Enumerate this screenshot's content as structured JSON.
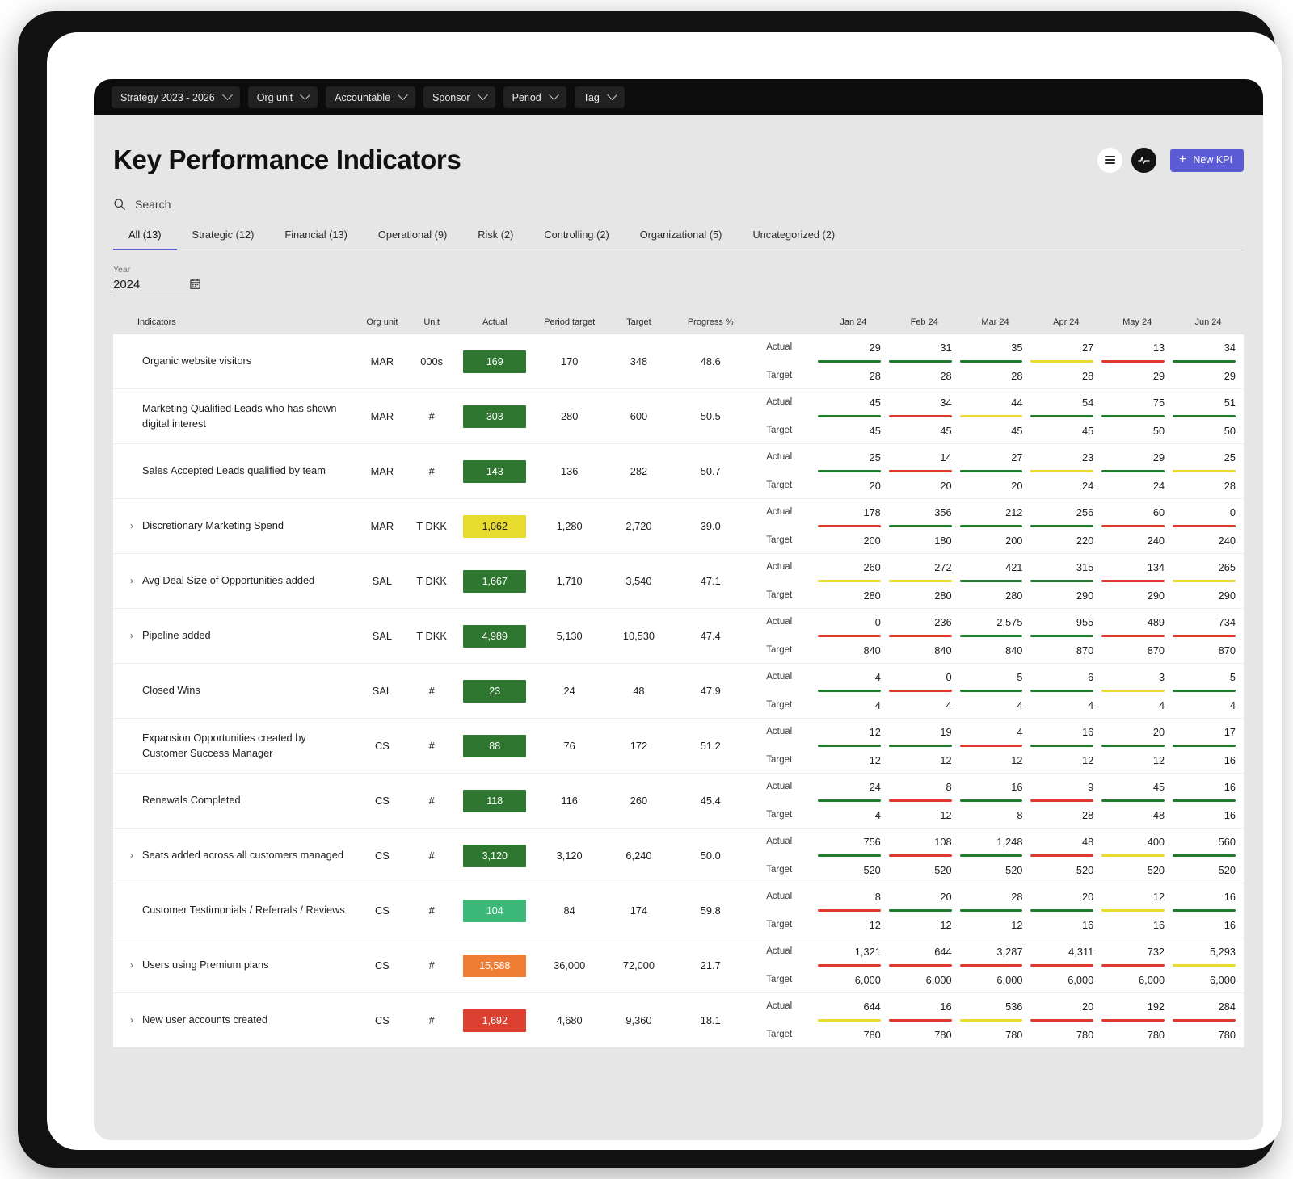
{
  "filters": [
    {
      "label": "Strategy 2023 - 2026",
      "name": "strategy"
    },
    {
      "label": "Org unit",
      "name": "org-unit"
    },
    {
      "label": "Accountable",
      "name": "accountable"
    },
    {
      "label": "Sponsor",
      "name": "sponsor"
    },
    {
      "label": "Period",
      "name": "period"
    },
    {
      "label": "Tag",
      "name": "tag"
    }
  ],
  "header": {
    "title": "Key Performance Indicators",
    "new_kpi_label": "New KPI",
    "plus": "+"
  },
  "search": {
    "label": "Search"
  },
  "tabs": [
    {
      "label": "All (13)",
      "active": true
    },
    {
      "label": "Strategic (12)",
      "active": false
    },
    {
      "label": "Financial (13)",
      "active": false
    },
    {
      "label": "Operational (9)",
      "active": false
    },
    {
      "label": "Risk (2)",
      "active": false
    },
    {
      "label": "Controlling (2)",
      "active": false
    },
    {
      "label": "Organizational (5)",
      "active": false
    },
    {
      "label": "Uncategorized (2)",
      "active": false
    }
  ],
  "year_filter": {
    "label": "Year",
    "value": "2024",
    "icon": "Ὄ5"
  },
  "table": {
    "columns": {
      "indicators": "Indicators",
      "org_unit": "Org unit",
      "unit": "Unit",
      "actual": "Actual",
      "period_target": "Period target",
      "target": "Target",
      "progress": "Progress %"
    },
    "months": [
      "Jan 24",
      "Feb 24",
      "Mar 24",
      "Apr 24",
      "May 24",
      "Jun 24"
    ],
    "series_labels": {
      "actual": "Actual",
      "target": "Target"
    },
    "colors": {
      "badge_green_dark": "#2f7731",
      "badge_green_light": "#3cb878",
      "badge_yellow": "#e8dc2e",
      "badge_orange": "#ef7d34",
      "badge_red": "#dc4030",
      "bar_green": "#1f7a2e",
      "bar_red": "#e03a2f",
      "bar_yellow": "#e9dc2c",
      "accent": "#5b5bd6"
    },
    "rows": [
      {
        "expandable": false,
        "indicator": "Organic website visitors",
        "org_unit": "MAR",
        "unit": "000s",
        "actual": "169",
        "badge_color": "#2f7731",
        "period_target": "170",
        "target": "348",
        "progress": "48.6",
        "monthly_actual": [
          "29",
          "31",
          "35",
          "27",
          "13",
          "34"
        ],
        "monthly_target": [
          "28",
          "28",
          "28",
          "28",
          "29",
          "29"
        ],
        "status": [
          "green",
          "green",
          "green",
          "yellow",
          "red",
          "green"
        ]
      },
      {
        "expandable": false,
        "indicator": "Marketing Qualified Leads who has shown digital interest",
        "org_unit": "MAR",
        "unit": "#",
        "actual": "303",
        "badge_color": "#2f7731",
        "period_target": "280",
        "target": "600",
        "progress": "50.5",
        "monthly_actual": [
          "45",
          "34",
          "44",
          "54",
          "75",
          "51"
        ],
        "monthly_target": [
          "45",
          "45",
          "45",
          "45",
          "50",
          "50"
        ],
        "status": [
          "green",
          "red",
          "yellow",
          "green",
          "green",
          "green"
        ]
      },
      {
        "expandable": false,
        "indicator": "Sales Accepted Leads qualified by team",
        "org_unit": "MAR",
        "unit": "#",
        "actual": "143",
        "badge_color": "#2f7731",
        "period_target": "136",
        "target": "282",
        "progress": "50.7",
        "monthly_actual": [
          "25",
          "14",
          "27",
          "23",
          "29",
          "25"
        ],
        "monthly_target": [
          "20",
          "20",
          "20",
          "24",
          "24",
          "28"
        ],
        "status": [
          "green",
          "red",
          "green",
          "yellow",
          "green",
          "yellow"
        ]
      },
      {
        "expandable": true,
        "indicator": "Discretionary Marketing Spend",
        "org_unit": "MAR",
        "unit": "T DKK",
        "actual": "1,062",
        "badge_color": "#e8dc2e",
        "badge_text_color": "#1e1e1e",
        "period_target": "1,280",
        "target": "2,720",
        "progress": "39.0",
        "monthly_actual": [
          "178",
          "356",
          "212",
          "256",
          "60",
          "0"
        ],
        "monthly_target": [
          "200",
          "180",
          "200",
          "220",
          "240",
          "240"
        ],
        "status": [
          "red",
          "green",
          "green",
          "green",
          "red",
          "red"
        ]
      },
      {
        "expandable": true,
        "indicator": "Avg Deal Size of Opportunities added",
        "org_unit": "SAL",
        "unit": "T DKK",
        "actual": "1,667",
        "badge_color": "#2f7731",
        "period_target": "1,710",
        "target": "3,540",
        "progress": "47.1",
        "monthly_actual": [
          "260",
          "272",
          "421",
          "315",
          "134",
          "265"
        ],
        "monthly_target": [
          "280",
          "280",
          "280",
          "290",
          "290",
          "290"
        ],
        "status": [
          "yellow",
          "yellow",
          "green",
          "green",
          "red",
          "yellow"
        ]
      },
      {
        "expandable": true,
        "indicator": "Pipeline added",
        "org_unit": "SAL",
        "unit": "T DKK",
        "actual": "4,989",
        "badge_color": "#2f7731",
        "period_target": "5,130",
        "target": "10,530",
        "progress": "47.4",
        "monthly_actual": [
          "0",
          "236",
          "2,575",
          "955",
          "489",
          "734"
        ],
        "monthly_target": [
          "840",
          "840",
          "840",
          "870",
          "870",
          "870"
        ],
        "status": [
          "red",
          "red",
          "green",
          "green",
          "red",
          "red"
        ]
      },
      {
        "expandable": false,
        "indicator": "Closed Wins",
        "org_unit": "SAL",
        "unit": "#",
        "actual": "23",
        "badge_color": "#2f7731",
        "period_target": "24",
        "target": "48",
        "progress": "47.9",
        "monthly_actual": [
          "4",
          "0",
          "5",
          "6",
          "3",
          "5"
        ],
        "monthly_target": [
          "4",
          "4",
          "4",
          "4",
          "4",
          "4"
        ],
        "status": [
          "green",
          "red",
          "green",
          "green",
          "yellow",
          "green"
        ]
      },
      {
        "expandable": false,
        "indicator": "Expansion Opportunities created by Customer Success Manager",
        "org_unit": "CS",
        "unit": "#",
        "actual": "88",
        "badge_color": "#2f7731",
        "period_target": "76",
        "target": "172",
        "progress": "51.2",
        "monthly_actual": [
          "12",
          "19",
          "4",
          "16",
          "20",
          "17"
        ],
        "monthly_target": [
          "12",
          "12",
          "12",
          "12",
          "12",
          "16"
        ],
        "status": [
          "green",
          "green",
          "red",
          "green",
          "green",
          "green"
        ]
      },
      {
        "expandable": false,
        "indicator": "Renewals Completed",
        "org_unit": "CS",
        "unit": "#",
        "actual": "118",
        "badge_color": "#2f7731",
        "period_target": "116",
        "target": "260",
        "progress": "45.4",
        "monthly_actual": [
          "24",
          "8",
          "16",
          "9",
          "45",
          "16"
        ],
        "monthly_target": [
          "4",
          "12",
          "8",
          "28",
          "48",
          "16"
        ],
        "status": [
          "green",
          "red",
          "green",
          "red",
          "green",
          "green"
        ]
      },
      {
        "expandable": true,
        "indicator": "Seats added across all customers managed",
        "org_unit": "CS",
        "unit": "#",
        "actual": "3,120",
        "badge_color": "#2f7731",
        "period_target": "3,120",
        "target": "6,240",
        "progress": "50.0",
        "monthly_actual": [
          "756",
          "108",
          "1,248",
          "48",
          "400",
          "560"
        ],
        "monthly_target": [
          "520",
          "520",
          "520",
          "520",
          "520",
          "520"
        ],
        "status": [
          "green",
          "red",
          "green",
          "red",
          "yellow",
          "green"
        ]
      },
      {
        "expandable": false,
        "indicator": "Customer Testimonials / Referrals / Reviews",
        "org_unit": "CS",
        "unit": "#",
        "actual": "104",
        "badge_color": "#3cb878",
        "period_target": "84",
        "target": "174",
        "progress": "59.8",
        "monthly_actual": [
          "8",
          "20",
          "28",
          "20",
          "12",
          "16"
        ],
        "monthly_target": [
          "12",
          "12",
          "12",
          "16",
          "16",
          "16"
        ],
        "status": [
          "red",
          "green",
          "green",
          "green",
          "yellow",
          "green"
        ]
      },
      {
        "expandable": true,
        "indicator": "Users using Premium plans",
        "org_unit": "CS",
        "unit": "#",
        "actual": "15,588",
        "badge_color": "#ef7d34",
        "period_target": "36,000",
        "target": "72,000",
        "progress": "21.7",
        "monthly_actual": [
          "1,321",
          "644",
          "3,287",
          "4,311",
          "732",
          "5,293"
        ],
        "monthly_target": [
          "6,000",
          "6,000",
          "6,000",
          "6,000",
          "6,000",
          "6,000"
        ],
        "status": [
          "red",
          "red",
          "red",
          "red",
          "red",
          "yellow"
        ]
      },
      {
        "expandable": true,
        "indicator": "New user accounts created",
        "org_unit": "CS",
        "unit": "#",
        "actual": "1,692",
        "badge_color": "#dc4030",
        "period_target": "4,680",
        "target": "9,360",
        "progress": "18.1",
        "monthly_actual": [
          "644",
          "16",
          "536",
          "20",
          "192",
          "284"
        ],
        "monthly_target": [
          "780",
          "780",
          "780",
          "780",
          "780",
          "780"
        ],
        "status": [
          "yellow",
          "red",
          "yellow",
          "red",
          "red",
          "red"
        ]
      }
    ]
  }
}
